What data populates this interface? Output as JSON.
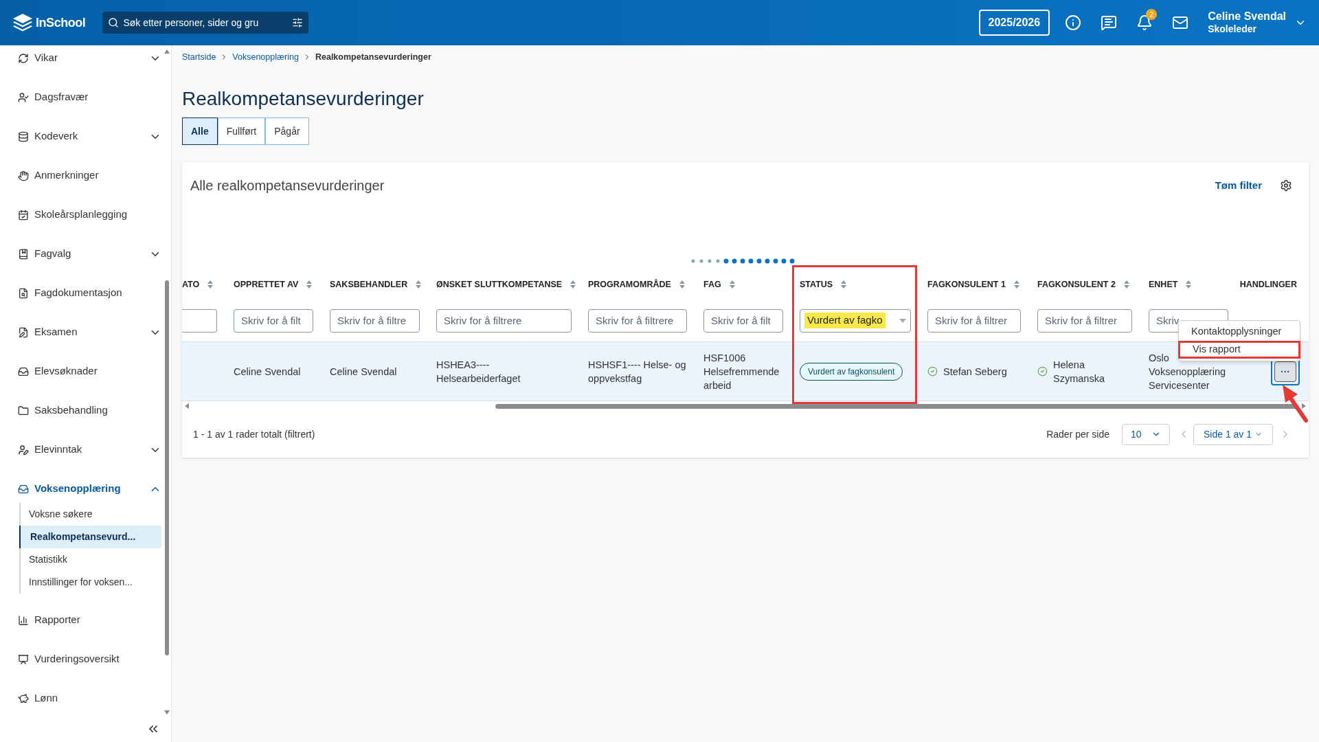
{
  "topbar": {
    "logo": "InSchool",
    "search": {
      "placeholder": "Søk etter personer, sider og gru"
    },
    "school_year": "2025/2026",
    "notification_count": "2",
    "user": {
      "name": "Celine Svendal",
      "role": "Skoleleder"
    }
  },
  "sidebar": {
    "items": [
      {
        "label": "Vikar",
        "kind": "group",
        "expanded": false,
        "selected": false
      },
      {
        "label": "Dagsfravær",
        "kind": "link",
        "selected": false
      },
      {
        "label": "Kodeverk",
        "kind": "group",
        "expanded": false,
        "selected": false
      },
      {
        "label": "Anmerkninger",
        "kind": "link",
        "selected": false
      },
      {
        "label": "Skoleårsplanlegging",
        "kind": "link",
        "selected": false
      },
      {
        "label": "Fagvalg",
        "kind": "group",
        "expanded": false,
        "selected": false
      },
      {
        "label": "Fagdokumentasjon",
        "kind": "link",
        "selected": false
      },
      {
        "label": "Eksamen",
        "kind": "group",
        "expanded": false,
        "selected": false
      },
      {
        "label": "Elevsøknader",
        "kind": "link",
        "selected": false
      },
      {
        "label": "Saksbehandling",
        "kind": "link",
        "selected": false
      },
      {
        "label": "Elevinntak",
        "kind": "group",
        "expanded": false,
        "selected": false
      },
      {
        "label": "Voksenopplæring",
        "kind": "group",
        "expanded": true,
        "selected": true,
        "children": [
          {
            "label": "Voksne søkere",
            "selected": false
          },
          {
            "label": "Realkompetansevurd...",
            "selected": true
          },
          {
            "label": "Statistikk",
            "selected": false
          },
          {
            "label": "Innstillinger for voksen...",
            "selected": false
          }
        ]
      },
      {
        "label": "Rapporter",
        "kind": "link",
        "selected": false
      },
      {
        "label": "Vurderingsoversikt",
        "kind": "link",
        "selected": false
      },
      {
        "label": "Lønn",
        "kind": "link",
        "selected": false
      }
    ]
  },
  "breadcrumb": [
    {
      "label": "Startside",
      "current": false
    },
    {
      "label": "Voksenopplæring",
      "current": false
    },
    {
      "label": "Realkompetansevurderinger",
      "current": true
    }
  ],
  "page_title": "Realkompetansevurderinger",
  "tabs": [
    {
      "label": "Alle",
      "selected": true
    },
    {
      "label": "Fullført",
      "selected": false
    },
    {
      "label": "Pågår",
      "selected": false
    }
  ],
  "card": {
    "title": "Alle realkompetansevurderinger",
    "clear_filter": "Tøm filter",
    "table": {
      "columns": [
        {
          "label": "ATO",
          "sortable": true,
          "outlined": false
        },
        {
          "label": "OPPRETTET AV",
          "sortable": true,
          "outlined": false
        },
        {
          "label": "SAKSBEHANDLER",
          "sortable": true,
          "outlined": false
        },
        {
          "label": "ØNSKET SLUTTKOMPETANSE",
          "sortable": true,
          "outlined": false
        },
        {
          "label": "PROGRAMOMRÅDE",
          "sortable": true,
          "outlined": false
        },
        {
          "label": "FAG",
          "sortable": true,
          "outlined": false
        },
        {
          "label": "STATUS",
          "sortable": true,
          "outlined": true
        },
        {
          "label": "FAGKONSULENT 1",
          "sortable": true,
          "outlined": false
        },
        {
          "label": "FAGKONSULENT 2",
          "sortable": true,
          "outlined": false
        },
        {
          "label": "ENHET",
          "sortable": true,
          "outlined": false
        },
        {
          "label": "HANDLINGER",
          "sortable": false,
          "outlined": false
        }
      ],
      "filters": [
        {
          "kind": "text"
        },
        {
          "kind": "text",
          "placeholder": "Skriv for å filt"
        },
        {
          "kind": "text",
          "placeholder": "Skriv for å filtre"
        },
        {
          "kind": "text",
          "placeholder": "Skriv for å filtrere"
        },
        {
          "kind": "text",
          "placeholder": "Skriv for å filtrere"
        },
        {
          "kind": "text",
          "placeholder": "Skriv for å filt"
        },
        {
          "kind": "select",
          "value": "Vurdert av fagko",
          "highlighted": true
        },
        {
          "kind": "text",
          "placeholder": "Skriv for å filtrer"
        },
        {
          "kind": "text",
          "placeholder": "Skriv for å filtrer"
        },
        {
          "kind": "text",
          "placeholder": "Skriv"
        },
        {
          "kind": "none"
        }
      ],
      "rows": [
        {
          "selected": true,
          "cells": [
            {
              "kind": "text"
            },
            {
              "kind": "text",
              "text": "Celine Svendal"
            },
            {
              "kind": "text",
              "text": "Celine Svendal"
            },
            {
              "kind": "text",
              "text": "HSHEA3----\nHelsearbeiderfaget"
            },
            {
              "kind": "text",
              "text": "HSHSF1---- Helse- og\noppvekstfag"
            },
            {
              "kind": "text",
              "text": "HSF1006\nHelsefremmende\narbeid"
            },
            {
              "kind": "badge",
              "text": "Vurdert av fagkonsulent"
            },
            {
              "kind": "person",
              "text": "Stefan Seberg"
            },
            {
              "kind": "person",
              "text": "Helena\nSzymanska"
            },
            {
              "kind": "text",
              "text": "Oslo\nVoksenopplæring\nServicesenter"
            },
            {
              "kind": "actions",
              "text": "···"
            }
          ]
        }
      ],
      "actions_menu": [
        {
          "label": "Kontaktopplysninger",
          "outlined": false
        },
        {
          "label": "Vis rapport",
          "outlined": true
        }
      ]
    },
    "footer": {
      "summary": "1 - 1 av 1 rader totalt (filtrert)",
      "rows_per_page_label": "Rader per side",
      "rows_per_page": "10",
      "page": "Side 1 av 1"
    }
  }
}
